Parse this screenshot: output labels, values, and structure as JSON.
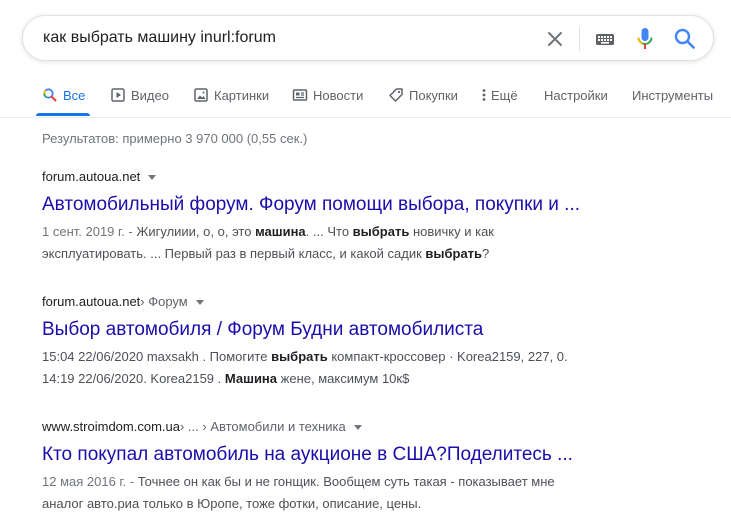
{
  "search": {
    "query": "как выбрать машину inurl:forum"
  },
  "tabs": [
    {
      "label": "Все",
      "icon": "search-icon",
      "active": true
    },
    {
      "label": "Видео",
      "icon": "video-icon"
    },
    {
      "label": "Картинки",
      "icon": "image-icon"
    },
    {
      "label": "Новости",
      "icon": "news-icon"
    },
    {
      "label": "Покупки",
      "icon": "tag-icon"
    },
    {
      "label": "Ещё",
      "icon": "more-icon"
    },
    {
      "label": "Настройки"
    },
    {
      "label": "Инструменты"
    }
  ],
  "stats": "Результатов: примерно 3 970 000 (0,55 сек.)",
  "results": [
    {
      "site": "forum.autoua.net",
      "path": "",
      "title": "Автомобильный форум. Форум помощи выбора, покупки и ...",
      "date": "1 сент. 2019 г. - ",
      "line1": [
        {
          "t": "Жигулиии, о, о, это ",
          "b": false
        },
        {
          "t": "машина",
          "b": true
        },
        {
          "t": ". ... Что ",
          "b": false
        },
        {
          "t": "выбрать",
          "b": true
        },
        {
          "t": " новичку и как",
          "b": false
        }
      ],
      "line2": [
        {
          "t": "эксплуатировать. ... Первый раз в первый класс, и какой садик ",
          "b": false
        },
        {
          "t": "выбрать",
          "b": true
        },
        {
          "t": "?",
          "b": false
        }
      ]
    },
    {
      "site": "forum.autoua.net",
      "path": " › Форум",
      "title": "Выбор автомобиля / Форум Будни автомобилиста",
      "date": "",
      "line1": [
        {
          "t": "15:04 22/06/2020 maxsakh . Помогите ",
          "b": false
        },
        {
          "t": "выбрать",
          "b": true
        },
        {
          "t": " компакт-кроссовер · Korea2159, 227, 0.",
          "b": false
        }
      ],
      "line2": [
        {
          "t": "14:19 22/06/2020. Korea2159 . ",
          "b": false
        },
        {
          "t": "Машина",
          "b": true
        },
        {
          "t": " жене, максимум 10к$",
          "b": false
        }
      ]
    },
    {
      "site": "www.stroimdom.com.ua",
      "path": " › ... › Автомобили и техника",
      "title": "Кто покупал автомобиль на аукционе в США?Поделитесь ...",
      "date": "12 мая 2016 г. - ",
      "line1": [
        {
          "t": "Точнее он как бы и не гонщик. Вообщем суть такая - показывает мне",
          "b": false
        }
      ],
      "line2": [
        {
          "t": "аналог авто.риа только в Юропе, тоже фотки, описание, цены.",
          "b": false
        }
      ]
    }
  ],
  "colors": {
    "link": "#1a0dab",
    "accent": "#1a73e8",
    "muted": "#70757a"
  }
}
